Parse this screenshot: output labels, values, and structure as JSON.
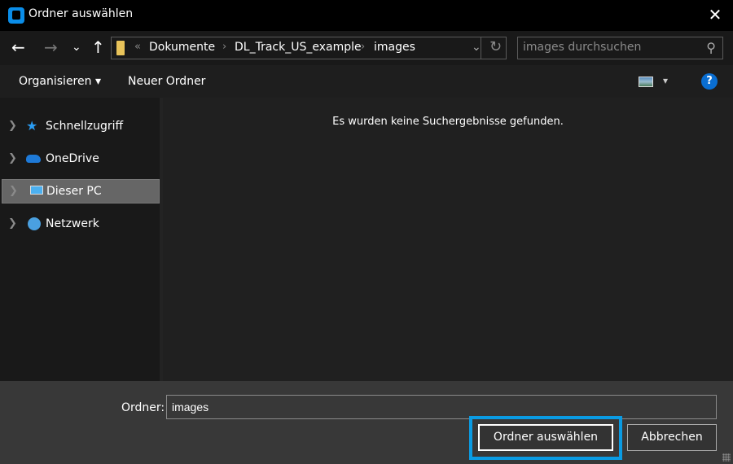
{
  "window": {
    "title": "Ordner auswählen",
    "close": "✕"
  },
  "nav": {
    "back": "←",
    "forward": "→",
    "recent": "⌄",
    "up": "↑"
  },
  "address": {
    "overflow": "«",
    "crumbs": [
      "Dokumente",
      "DL_Track_US_example",
      "images"
    ],
    "sep": "›",
    "dropdown": "⌄",
    "refresh": "↻"
  },
  "search": {
    "placeholder": "images durchsuchen",
    "icon": "⚲"
  },
  "toolbar": {
    "organize": "Organisieren ▾",
    "new_folder": "Neuer Ordner",
    "view_menu": "▾",
    "help": "?"
  },
  "sidebar": {
    "items": [
      {
        "label": "Schnellzugriff"
      },
      {
        "label": "OneDrive"
      },
      {
        "label": "Dieser PC",
        "selected": true
      },
      {
        "label": "Netzwerk"
      }
    ]
  },
  "content": {
    "empty_message": "Es wurden keine Suchergebnisse gefunden."
  },
  "footer": {
    "folder_label": "Ordner:",
    "folder_value": "images",
    "ok": "Ordner auswählen",
    "cancel": "Abbrechen"
  },
  "colors": {
    "accent": "#0a9be3"
  }
}
